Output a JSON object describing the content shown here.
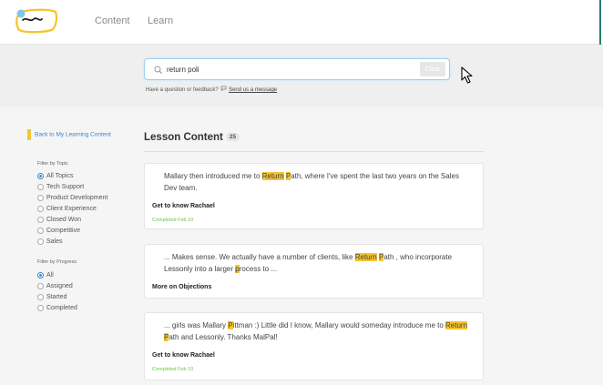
{
  "nav": {
    "content": "Content",
    "learn": "Learn"
  },
  "search": {
    "value": "return poli",
    "placeholder": "",
    "clear_label": "Clear"
  },
  "feedback": {
    "prefix": "Have a question or feedback?",
    "link": "Send us a message"
  },
  "sidebar": {
    "back_label": "Back to My Learning Content",
    "topic_title": "Filter by Topic",
    "topics": [
      "All Topics",
      "Tech Support",
      "Product Development",
      "Client Experience",
      "Closed Won",
      "Competitive",
      "Sales"
    ],
    "selected_topic": "All Topics",
    "progress_title": "Filter by Progress",
    "progress": [
      "All",
      "Assigned",
      "Started",
      "Completed"
    ],
    "selected_progress": "All"
  },
  "main": {
    "title": "Lesson Content",
    "count": "25",
    "cards": [
      {
        "snippet": [
          {
            "t": "Mallary then introduced me to "
          },
          {
            "t": "Return",
            "h": true
          },
          {
            "t": " "
          },
          {
            "t": "P",
            "h": true
          },
          {
            "t": "ath, where I've spent the last two years on the Sales Dev team."
          }
        ],
        "title": "Get to know Rachael",
        "status": "Completed Feb 10"
      },
      {
        "snippet": [
          {
            "t": "... Makes sense. We actually have a number of clients, like "
          },
          {
            "t": "Return",
            "h": true
          },
          {
            "t": " "
          },
          {
            "t": "P",
            "h": true
          },
          {
            "t": "ath , who incorporate Lessonly into a larger "
          },
          {
            "t": "p",
            "h": true
          },
          {
            "t": "rocess to ..."
          }
        ],
        "title": "More on Objections",
        "status": ""
      },
      {
        "snippet": [
          {
            "t": "... girls was Mallary "
          },
          {
            "t": "P",
            "h": true
          },
          {
            "t": "ittman :)  Little did I know, Mallary would someday introduce me to "
          },
          {
            "t": "Return",
            "h": true
          },
          {
            "t": " "
          },
          {
            "t": "P",
            "h": true
          },
          {
            "t": "ath and Lessonly.  Thanks MalPal!"
          }
        ],
        "title": "Get to know Rachael",
        "status": "Completed Feb 10"
      }
    ]
  },
  "colors": {
    "accent": "#3a86c6",
    "highlight": "#f4c430",
    "success": "#6cc24a",
    "brand_teal": "#2e7d6f"
  },
  "icons": {
    "logo": "lessonly-logo",
    "search": "search-icon",
    "feedback": "chat-icon",
    "cursor": "mouse-pointer-icon"
  }
}
